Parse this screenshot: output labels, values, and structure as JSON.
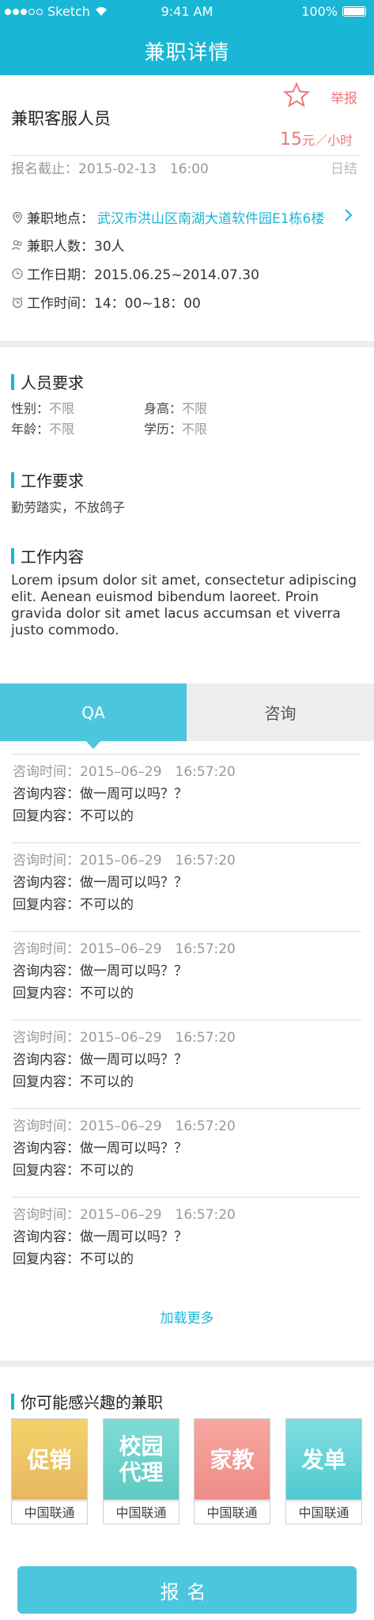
{
  "status_bar": {
    "carrier": "Sketch",
    "time": "9:41 AM",
    "battery": "100%"
  },
  "nav": {
    "title": "兼职详情"
  },
  "job": {
    "title": "兼职客服人员",
    "report_label": "举报",
    "price_amount": "15",
    "price_unit": "元／小时",
    "deadline": "报名截止：2015-02-13　16:00",
    "deadline_status": "日结",
    "location_label": "兼职地点：",
    "location_value": "武汉市洪山区南湖大道软件园E1栋6楼",
    "people": "兼职人数：30人",
    "dates": "工作日期：2015.06.25~2014.07.30",
    "hours": "工作时间：14：00~18：00"
  },
  "requirements": {
    "heading": "人员要求",
    "gender_label": "性别：",
    "gender_value": "不限",
    "height_label": "身高：",
    "height_value": "不限",
    "age_label": "年龄：",
    "age_value": "不限",
    "edu_label": "学历：",
    "edu_value": "不限"
  },
  "work_req": {
    "heading": "工作要求",
    "text": "勤劳踏实，不放鸽子"
  },
  "work_content": {
    "heading": "工作内容",
    "text": "Lorem ipsum dolor sit amet, consectetur adipiscing elit. Aenean euismod bibendum laoreet. Proin gravida dolor sit amet lacus accumsan et viverra justo commodo."
  },
  "tabs": [
    {
      "label": "QA"
    },
    {
      "label": "咨询"
    }
  ],
  "qa_items": [
    {
      "time": "咨询时间：2015–06–29　16:57:20",
      "question": "咨询内容：做一周可以吗？？",
      "answer": "回复内容：不可以的"
    },
    {
      "time": "咨询时间：2015–06–29　16:57:20",
      "question": "咨询内容：做一周可以吗？？",
      "answer": "回复内容：不可以的"
    },
    {
      "time": "咨询时间：2015–06–29　16:57:20",
      "question": "咨询内容：做一周可以吗？？",
      "answer": "回复内容：不可以的"
    },
    {
      "time": "咨询时间：2015–06–29　16:57:20",
      "question": "咨询内容：做一周可以吗？？",
      "answer": "回复内容：不可以的"
    },
    {
      "time": "咨询时间：2015–06–29　16:57:20",
      "question": "咨询内容：做一周可以吗？？",
      "answer": "回复内容：不可以的"
    },
    {
      "time": "咨询时间：2015–06–29　16:57:20",
      "question": "咨询内容：做一周可以吗？？",
      "answer": "回复内容：不可以的"
    }
  ],
  "load_more": "加载更多",
  "recommend": {
    "heading": "你可能感兴趣的兼职",
    "cards": [
      {
        "title": "促销",
        "caption": "中国联通",
        "color_top": "#f3d36b",
        "color_bottom": "#e7b760"
      },
      {
        "title": "校园\n代理",
        "caption": "中国联通",
        "color_top": "#7fdcd6",
        "color_bottom": "#5ec9c2"
      },
      {
        "title": "家教",
        "caption": "中国联通",
        "color_top": "#f6a8a0",
        "color_bottom": "#ee8c86"
      },
      {
        "title": "发单",
        "caption": "中国联通",
        "color_top": "#7fdce0",
        "color_bottom": "#4fcbd0"
      }
    ]
  },
  "signup_label": "报名",
  "colors": {
    "primary": "#1ab6d6",
    "accent": "#ef7777"
  }
}
